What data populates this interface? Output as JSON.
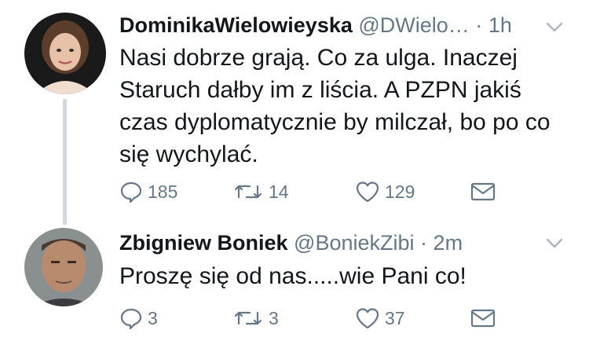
{
  "tweets": [
    {
      "author_name": "DominikaWielowieyska",
      "handle": "@DWielo…",
      "separator": "·",
      "time": "1h",
      "text": "Nasi dobrze grają. Co za ulga. Inaczej Staruch dałby im z liścia. A PZPN jakiś czas dyplomatycznie by milczał, bo po co się wychylać.",
      "replies": "185",
      "retweets": "14",
      "likes": "129"
    },
    {
      "author_name": "Zbigniew Boniek",
      "handle": "@BoniekZibi",
      "separator": "·",
      "time": "2m",
      "text": "Proszę się od nas.....wie Pani co!",
      "replies": "3",
      "retweets": "3",
      "likes": "37"
    }
  ],
  "icons": {
    "reply": "reply-icon",
    "retweet": "retweet-icon",
    "like": "heart-icon",
    "dm": "envelope-icon",
    "more": "chevron-down-icon"
  },
  "colors": {
    "text": "#14171a",
    "secondary": "#657786",
    "thread_line": "#cfd9de"
  }
}
